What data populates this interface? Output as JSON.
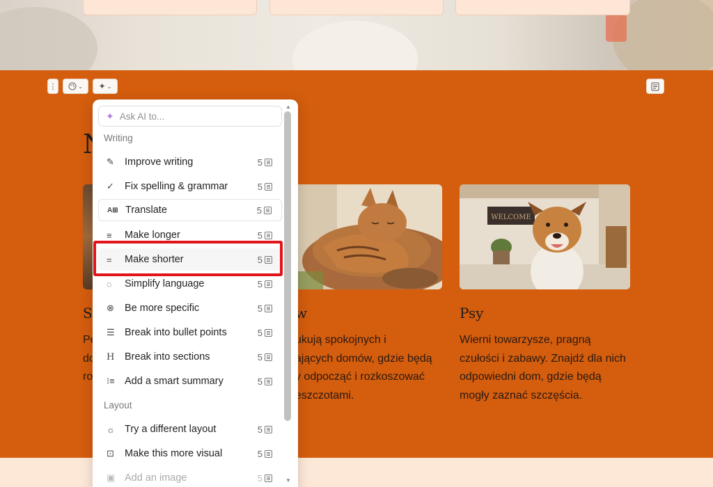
{
  "toolbar": {
    "drag_icon": "drag-handle-icon",
    "palette_icon": "palette-icon",
    "ai_icon": "sparkle-icon",
    "notes_icon": "notes-icon"
  },
  "section": {
    "heading": "N",
    "cards": [
      {
        "title": "Sz",
        "text": [
          "Pe",
          "do",
          "ro"
        ],
        "image": "cat-left"
      },
      {
        "title": "w",
        "text": [
          "ukują spokojnych i",
          "ających domów, gdzie będą",
          "y odpocząć i rozkoszować",
          "eszczotami."
        ],
        "image": "sleeping-cat"
      },
      {
        "title": "Psy",
        "text": [
          "Wierni towarzysze, pragną",
          "czułości i zabawy. Znajdź dla nich",
          "odpowiedni dom, gdzie będą",
          "mogły zaznać szczęścia."
        ],
        "image": "dog-welcome",
        "sign": "WELCOME"
      }
    ]
  },
  "ai_menu": {
    "ask_placeholder": "Ask AI to...",
    "groups": [
      {
        "label": "Writing",
        "items": [
          {
            "label": "Improve writing",
            "icon": "pen-icon",
            "cost": "5"
          },
          {
            "label": "Fix spelling & grammar",
            "icon": "check-icon",
            "cost": "5"
          },
          {
            "label": "Translate",
            "icon": "translate-icon",
            "cost": "5"
          },
          {
            "label": "Make longer",
            "icon": "lines-icon",
            "cost": "5"
          },
          {
            "label": "Make shorter",
            "icon": "short-lines-icon",
            "cost": "5"
          },
          {
            "label": "Simplify language",
            "icon": "speech-bubble-icon",
            "cost": "5"
          },
          {
            "label": "Be more specific",
            "icon": "target-icon",
            "cost": "5"
          },
          {
            "label": "Break into bullet points",
            "icon": "bullet-list-icon",
            "cost": "5"
          },
          {
            "label": "Break into sections",
            "icon": "heading-icon",
            "cost": "5"
          },
          {
            "label": "Add a smart summary",
            "icon": "summary-list-icon",
            "cost": "5"
          }
        ]
      },
      {
        "label": "Layout",
        "items": [
          {
            "label": "Try a different layout",
            "icon": "lightbulb-icon",
            "cost": "5"
          },
          {
            "label": "Make this more visual",
            "icon": "visual-icon",
            "cost": "5"
          },
          {
            "label": "Add an image",
            "icon": "image-icon",
            "cost": "5"
          }
        ]
      }
    ]
  }
}
